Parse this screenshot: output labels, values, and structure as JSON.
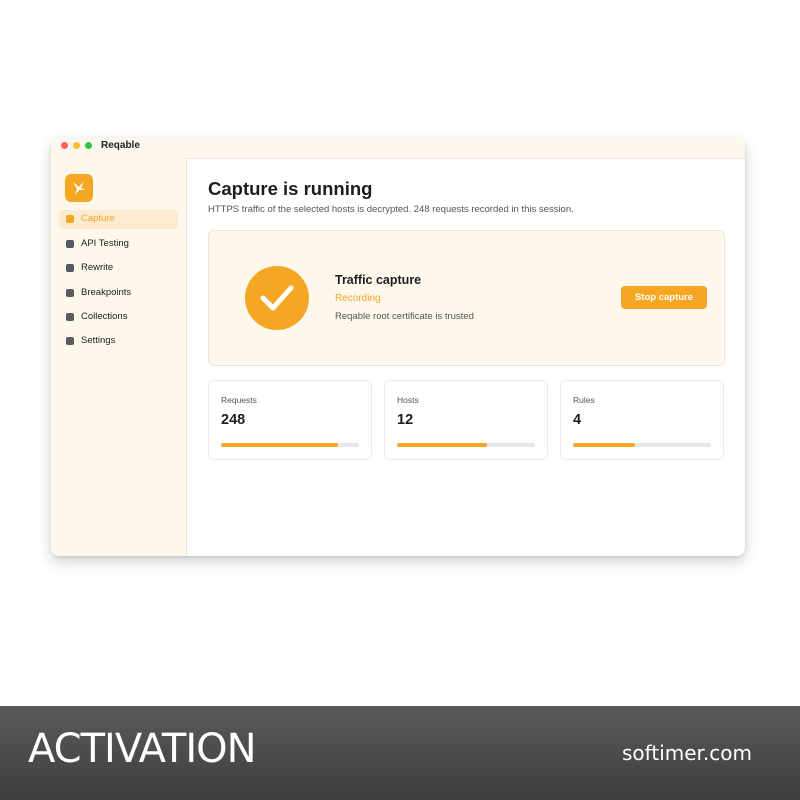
{
  "window": {
    "title": "Reqable"
  },
  "sidebar": {
    "items": [
      {
        "label": "Capture",
        "active": true
      },
      {
        "label": "API Testing",
        "active": false
      },
      {
        "label": "Rewrite",
        "active": false
      },
      {
        "label": "Breakpoints",
        "active": false
      },
      {
        "label": "Collections",
        "active": false
      },
      {
        "label": "Settings",
        "active": false
      }
    ]
  },
  "main": {
    "title": "Capture is running",
    "subtitle": "HTTPS traffic of the selected hosts is decrypted. 248 requests recorded in this session.",
    "capture": {
      "icon": "checkmark-circle-icon",
      "title": "Traffic capture",
      "status": "Recording",
      "note": "Reqable root certificate is trusted",
      "stop_label": "Stop capture"
    },
    "stats": [
      {
        "label": "Requests",
        "value": "248",
        "progress": 0.85
      },
      {
        "label": "Hosts",
        "value": "12",
        "progress": 0.65
      },
      {
        "label": "Rules",
        "value": "4",
        "progress": 0.45
      }
    ]
  },
  "colors": {
    "accent": "#f5a623",
    "sidebar_bg": "#fef7ec",
    "footer_bg": "#4a4a4a"
  },
  "footer": {
    "left_text": "ACTIVATION",
    "right_text": "softimer.com"
  }
}
